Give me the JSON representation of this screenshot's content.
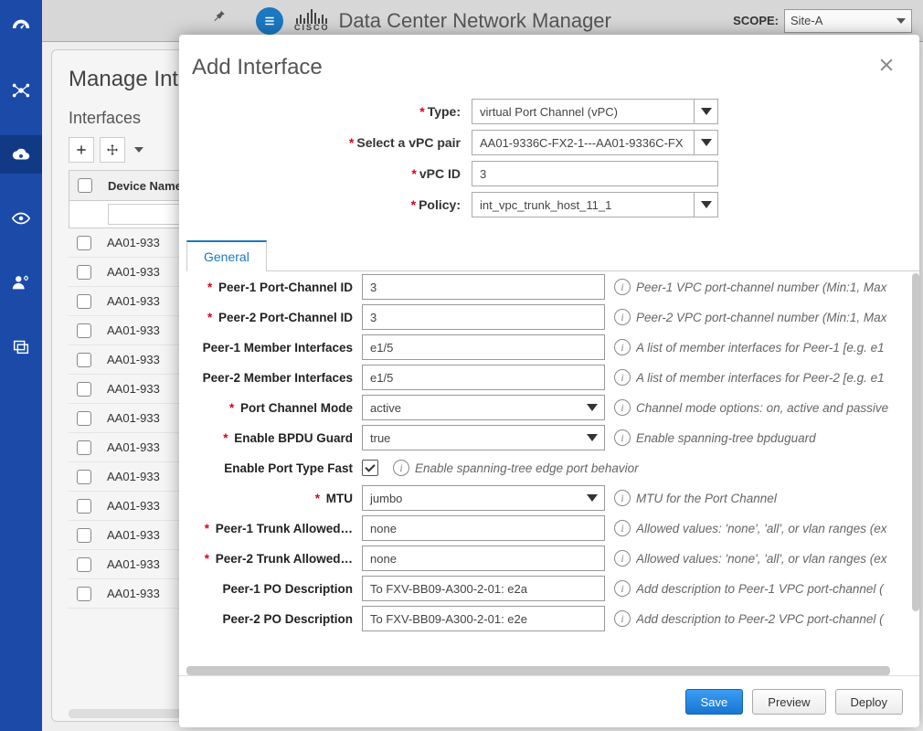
{
  "topbar": {
    "brand_text": "CISCO",
    "title": "Data Center Network Manager",
    "scope_label": "SCOPE:",
    "scope_value": "Site-A"
  },
  "background_page": {
    "title": "Manage Interfaces",
    "section": "Interfaces",
    "column_header": "Device Name",
    "rows": [
      "AA01-933",
      "AA01-933",
      "AA01-933",
      "AA01-933",
      "AA01-933",
      "AA01-933",
      "AA01-933",
      "AA01-933",
      "AA01-933",
      "AA01-933",
      "AA01-933",
      "AA01-933",
      "AA01-933"
    ]
  },
  "modal": {
    "title": "Add Interface",
    "top_form": {
      "type_label": "Type:",
      "type_value": "virtual Port Channel (vPC)",
      "pair_label": "Select a vPC pair",
      "pair_value": "AA01-9336C-FX2-1---AA01-9336C-FX",
      "vpc_id_label": "vPC ID",
      "vpc_id_value": "3",
      "policy_label": "Policy:",
      "policy_value": "int_vpc_trunk_host_11_1"
    },
    "tab_label": "General",
    "fields": [
      {
        "label": "Peer-1 Port-Channel ID",
        "req": true,
        "value": "3",
        "type": "text",
        "help": "Peer-1 VPC port-channel number (Min:1, Max"
      },
      {
        "label": "Peer-2 Port-Channel ID",
        "req": true,
        "value": "3",
        "type": "text",
        "help": "Peer-2 VPC port-channel number (Min:1, Max"
      },
      {
        "label": "Peer-1 Member Interfaces",
        "req": false,
        "value": "e1/5",
        "type": "text",
        "help": "A list of member interfaces for Peer-1 [e.g. e1"
      },
      {
        "label": "Peer-2 Member Interfaces",
        "req": false,
        "value": "e1/5",
        "type": "text",
        "help": "A list of member interfaces for Peer-2 [e.g. e1"
      },
      {
        "label": "Port Channel Mode",
        "req": true,
        "value": "active",
        "type": "select",
        "help": "Channel mode options: on, active and passive"
      },
      {
        "label": "Enable BPDU Guard",
        "req": true,
        "value": "true",
        "type": "select",
        "help": "Enable spanning-tree bpduguard"
      },
      {
        "label": "Enable Port Type Fast",
        "req": false,
        "value": "",
        "type": "checkbox",
        "help": "Enable spanning-tree edge port behavior"
      },
      {
        "label": "MTU",
        "req": true,
        "value": "jumbo",
        "type": "select",
        "help": "MTU for the Port Channel"
      },
      {
        "label": "Peer-1 Trunk Allowed…",
        "req": true,
        "value": "none",
        "type": "text",
        "help": "Allowed values: 'none', 'all', or vlan ranges (ex"
      },
      {
        "label": "Peer-2 Trunk Allowed…",
        "req": true,
        "value": "none",
        "type": "text",
        "help": "Allowed values: 'none', 'all', or vlan ranges (ex"
      },
      {
        "label": "Peer-1 PO Description",
        "req": false,
        "value": "To FXV-BB09-A300-2-01: e2a",
        "type": "text",
        "help": "Add description to Peer-1 VPC port-channel ("
      },
      {
        "label": "Peer-2 PO Description",
        "req": false,
        "value": "To FXV-BB09-A300-2-01: e2e",
        "type": "text",
        "help": "Add description to Peer-2 VPC port-channel ("
      }
    ],
    "footer": {
      "save": "Save",
      "preview": "Preview",
      "deploy": "Deploy"
    }
  }
}
